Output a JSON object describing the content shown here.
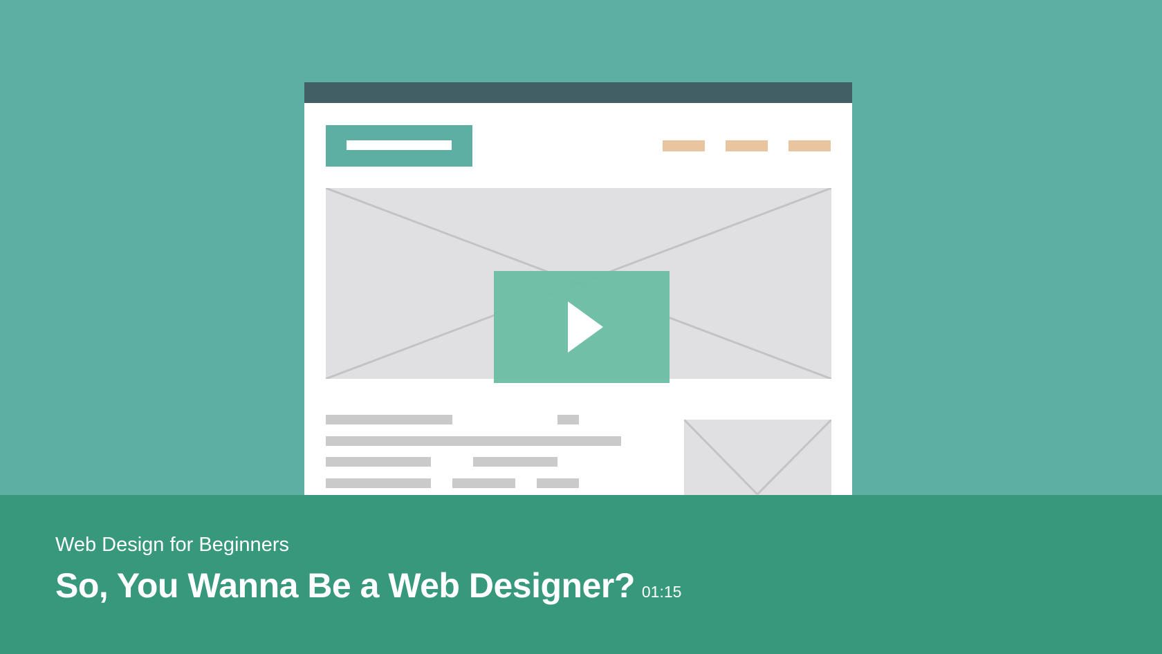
{
  "video": {
    "course_name": "Web Design for Beginners",
    "title": "So, You Wanna Be a Web Designer?",
    "duration": "01:15",
    "play_icon": "play-icon"
  },
  "colors": {
    "background": "#5daea3",
    "info_band": "#37987b",
    "play_button": "#6bbda3",
    "wireframe_bar": "#435f66",
    "wireframe_nav": "#e8c49f",
    "wireframe_placeholder": "#e0e0e2",
    "wireframe_text_line": "#cacaca"
  }
}
